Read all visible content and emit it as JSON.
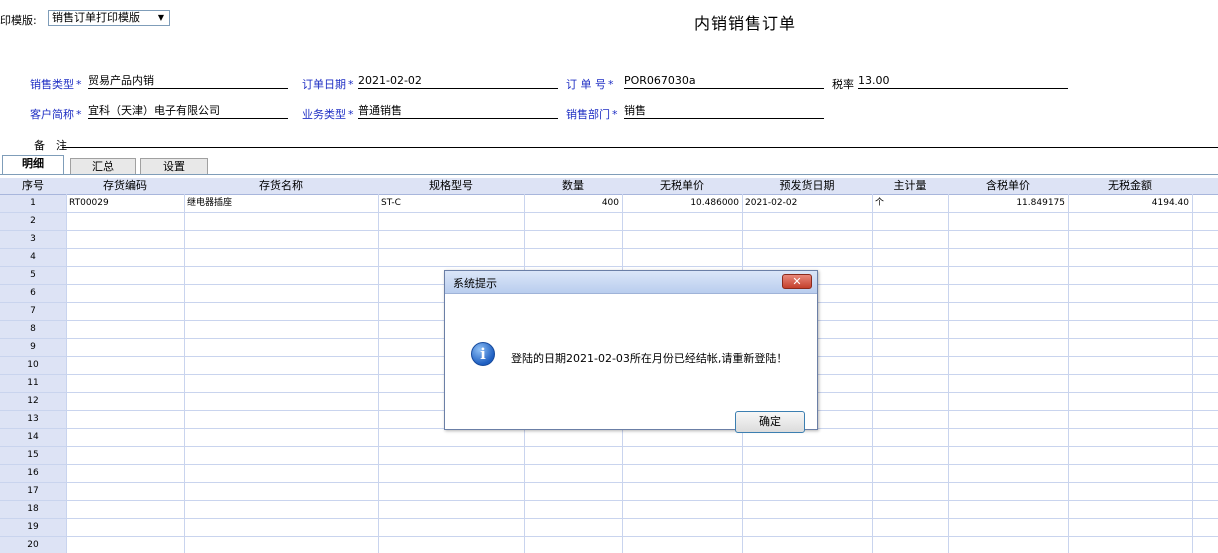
{
  "header": {
    "template_label": "印模版:",
    "template_value": "销售订单打印模版",
    "title": "内销销售订单"
  },
  "fields": {
    "sales_type_label": "销售类型",
    "sales_type_value": "贸易产品内销",
    "order_date_label": "订单日期",
    "order_date_value": "2021-02-02",
    "order_no_label": "订 单 号",
    "order_no_value": "POR067030a",
    "tax_rate_label": "税率",
    "tax_rate_value": "13.00",
    "customer_label": "客户简称",
    "customer_value": "宜科（天津）电子有限公司",
    "business_type_label": "业务类型",
    "business_type_value": "普通销售",
    "dept_label": "销售部门",
    "dept_value": "销售",
    "remark_label": "备　注",
    "required_mark": "*"
  },
  "tabs": [
    "明细",
    "汇总",
    "设置"
  ],
  "grid": {
    "columns": [
      "序号",
      "存货编码",
      "存货名称",
      "规格型号",
      "数量",
      "无税单价",
      "预发货日期",
      "主计量",
      "含税单价",
      "无税金额"
    ],
    "rows": [
      {
        "no": "1",
        "code": "RT00029",
        "name": "继电器插座",
        "spec": "ST-C",
        "qty": "400",
        "price": "10.486000",
        "date": "2021-02-02",
        "unit": "个",
        "tax_price": "11.849175",
        "amount": "4194.40"
      },
      {
        "no": "2"
      },
      {
        "no": "3"
      },
      {
        "no": "4"
      },
      {
        "no": "5"
      },
      {
        "no": "6"
      },
      {
        "no": "7"
      },
      {
        "no": "8"
      },
      {
        "no": "9"
      },
      {
        "no": "10"
      },
      {
        "no": "11"
      },
      {
        "no": "12"
      },
      {
        "no": "13"
      },
      {
        "no": "14"
      },
      {
        "no": "15"
      },
      {
        "no": "16"
      },
      {
        "no": "17"
      },
      {
        "no": "18"
      },
      {
        "no": "19"
      },
      {
        "no": "20"
      }
    ]
  },
  "dialog": {
    "title": "系统提示",
    "close_glyph": "✕",
    "message": "登陆的日期2021-02-03所在月份已经结帐,请重新登陆！",
    "ok_label": "确定",
    "icon": "info-icon"
  }
}
